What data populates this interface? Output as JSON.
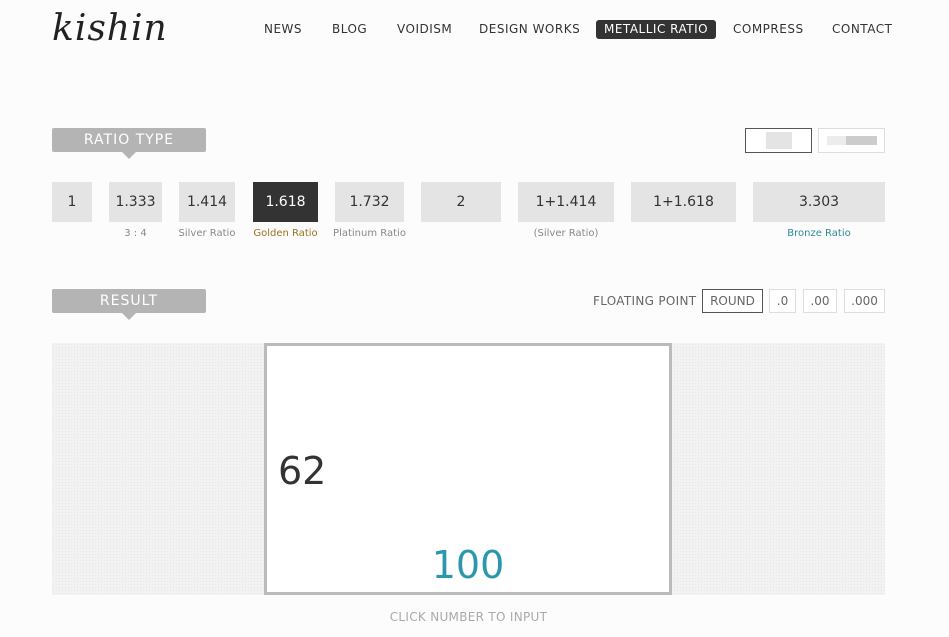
{
  "header": {
    "logo": "kishin",
    "nav": [
      "NEWS",
      "BLOG",
      "VOIDISM",
      "DESIGN WORKS",
      "METALLIC RATIO",
      "COMPRESS",
      "CONTACT"
    ],
    "active_nav": "METALLIC RATIO"
  },
  "ratio_type": {
    "title": "RATIO TYPE",
    "orientation_options": [
      "portrait-icon",
      "landscape-icon"
    ],
    "buttons": [
      {
        "value": "1",
        "label": ""
      },
      {
        "value": "1.333",
        "label": "3 : 4"
      },
      {
        "value": "1.414",
        "label": "Silver Ratio"
      },
      {
        "value": "1.618",
        "label": "Golden Ratio",
        "selected": true
      },
      {
        "value": "1.732",
        "label": "Platinum Ratio"
      },
      {
        "value": "2",
        "label": ""
      },
      {
        "value": "1+1.414",
        "label": "(Silver Ratio)"
      },
      {
        "value": "1+1.618",
        "label": ""
      },
      {
        "value": "3.303",
        "label": "Bronze Ratio"
      }
    ]
  },
  "result": {
    "title": "RESULT",
    "floating_label": "FLOATING POINT",
    "floating_options": [
      "ROUND",
      ".0",
      ".00",
      ".000"
    ],
    "selected_option": "ROUND",
    "height_value": "62",
    "width_value": "100",
    "hint": "CLICK NUMBER TO INPUT"
  },
  "colors": {
    "golden": "#9a7420",
    "bronze": "#2f8a95",
    "width_value": "#2a97ac",
    "selected": "#333333"
  }
}
